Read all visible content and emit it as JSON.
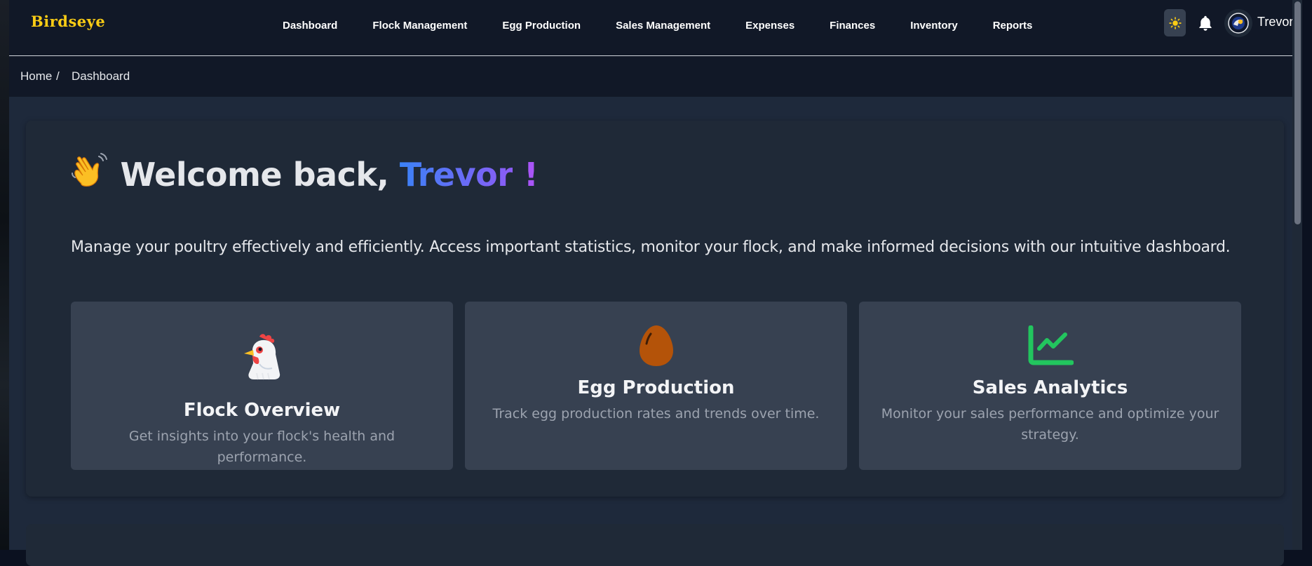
{
  "header": {
    "brand": "Birdseye",
    "nav": [
      {
        "label": "Dashboard"
      },
      {
        "label": "Flock Management"
      },
      {
        "label": "Egg Production"
      },
      {
        "label": "Sales Management"
      },
      {
        "label": "Expenses"
      },
      {
        "label": "Finances"
      },
      {
        "label": "Inventory"
      },
      {
        "label": "Reports"
      }
    ],
    "theme_icon": "sun-icon",
    "notification_icon": "bell-icon",
    "user_name": "Trevor"
  },
  "breadcrumb": {
    "home": "Home",
    "separator": "/",
    "current": "Dashboard"
  },
  "welcome": {
    "greeting": "Welcome back,",
    "name": "Trevor",
    "punctuation": "!",
    "intro": "Manage your poultry effectively and efficiently. Access important statistics, monitor your flock, and make informed decisions with our intuitive dashboard."
  },
  "features": [
    {
      "icon": "chicken-icon",
      "title": "Flock Overview",
      "description": "Get insights into your flock's health and performance."
    },
    {
      "icon": "egg-icon",
      "title": "Egg Production",
      "description": "Track egg production rates and trends over time."
    },
    {
      "icon": "chart-line-icon",
      "title": "Sales Analytics",
      "description": "Monitor your sales performance and optimize your strategy."
    }
  ],
  "colors": {
    "brand": "#facc15",
    "background": "#1e293b",
    "header": "#111827",
    "card": "#374151",
    "accent_blue": "#3b82f6",
    "accent_purple": "#a855f7",
    "chart_green": "#22c55e",
    "egg_brown": "#b45309"
  }
}
